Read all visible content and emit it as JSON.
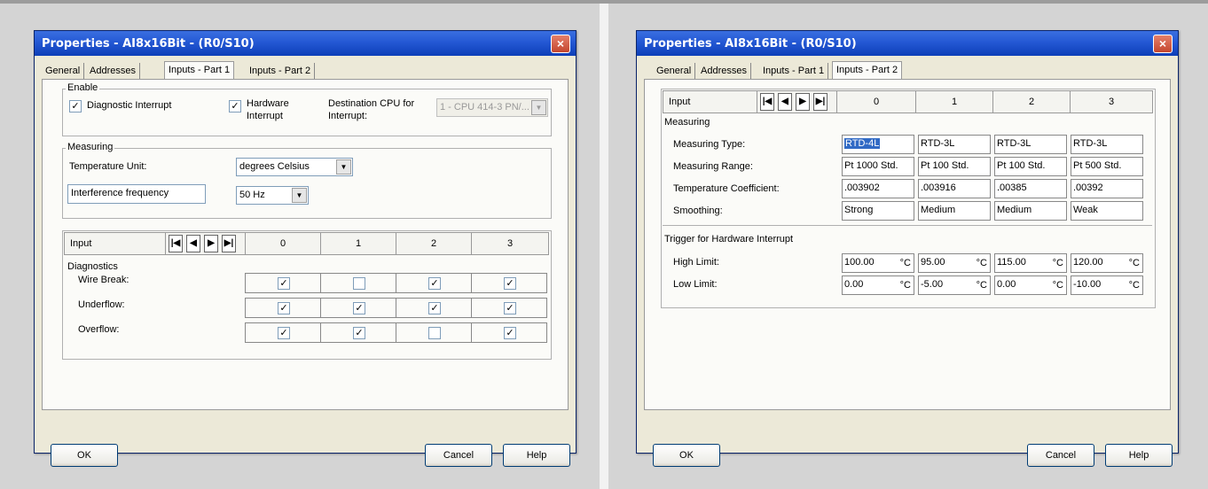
{
  "left": {
    "title": "Properties - AI8x16Bit - (R0/S10)",
    "close": "×",
    "tabs": [
      "General",
      "Addresses",
      "Inputs - Part 1",
      "Inputs - Part 2"
    ],
    "active_tab": "Inputs - Part 1",
    "enable": {
      "group": "Enable",
      "diagnostic_interrupt": {
        "label": "Diagnostic Interrupt",
        "checked": true
      },
      "hardware_interrupt": {
        "label1": "Hardware",
        "label2": "Interrupt",
        "checked": true
      },
      "dest_label1": "Destination CPU for",
      "dest_label2": "Interrupt:",
      "dest_value": "1 - CPU 414-3 PN/..."
    },
    "measuring": {
      "group": "Measuring",
      "temp_unit_label": "Temperature Unit:",
      "temp_unit_value": "degrees Celsius",
      "interference_label": "Interference frequency",
      "interference_value": "50 Hz"
    },
    "grid": {
      "input_label": "Input",
      "nav": [
        "|◀",
        "◀",
        "▶",
        "▶|"
      ],
      "columns": [
        "0",
        "1",
        "2",
        "3"
      ],
      "diagnostics_label": "Diagnostics",
      "rows": [
        {
          "label": "Wire Break:",
          "values": [
            true,
            false,
            true,
            true
          ]
        },
        {
          "label": "Underflow:",
          "values": [
            true,
            true,
            true,
            true
          ]
        },
        {
          "label": "Overflow:",
          "values": [
            true,
            true,
            false,
            true
          ]
        }
      ]
    },
    "buttons": {
      "ok": "OK",
      "cancel": "Cancel",
      "help": "Help"
    }
  },
  "right": {
    "title": "Properties - AI8x16Bit - (R0/S10)",
    "close": "×",
    "tabs": [
      "General",
      "Addresses",
      "Inputs - Part 1",
      "Inputs - Part 2"
    ],
    "active_tab": "Inputs - Part 2",
    "grid": {
      "input_label": "Input",
      "nav": [
        "|◀",
        "◀",
        "▶",
        "▶|"
      ],
      "columns": [
        "0",
        "1",
        "2",
        "3"
      ]
    },
    "measuring": {
      "section": "Measuring",
      "rows": [
        {
          "label": "Measuring Type:",
          "values": [
            "RTD-4L",
            "RTD-3L",
            "RTD-3L",
            "RTD-3L"
          ]
        },
        {
          "label": "Measuring Range:",
          "values": [
            "Pt 1000 Std.",
            "Pt 100 Std.",
            "Pt 100 Std.",
            "Pt 500 Std."
          ]
        },
        {
          "label": "Temperature Coefficient:",
          "values": [
            ".003902",
            ".003916",
            ".00385",
            ".00392"
          ]
        },
        {
          "label": "Smoothing:",
          "values": [
            "Strong",
            "Medium",
            "Medium",
            "Weak"
          ]
        }
      ]
    },
    "trigger": {
      "section": "Trigger for Hardware Interrupt",
      "unit": "°C",
      "rows": [
        {
          "label": "High Limit:",
          "values": [
            "100.00",
            "95.00",
            "115.00",
            "120.00"
          ]
        },
        {
          "label": "Low Limit:",
          "values": [
            "0.00",
            "-5.00",
            "0.00",
            "-10.00"
          ]
        }
      ]
    },
    "buttons": {
      "ok": "OK",
      "cancel": "Cancel",
      "help": "Help"
    }
  }
}
